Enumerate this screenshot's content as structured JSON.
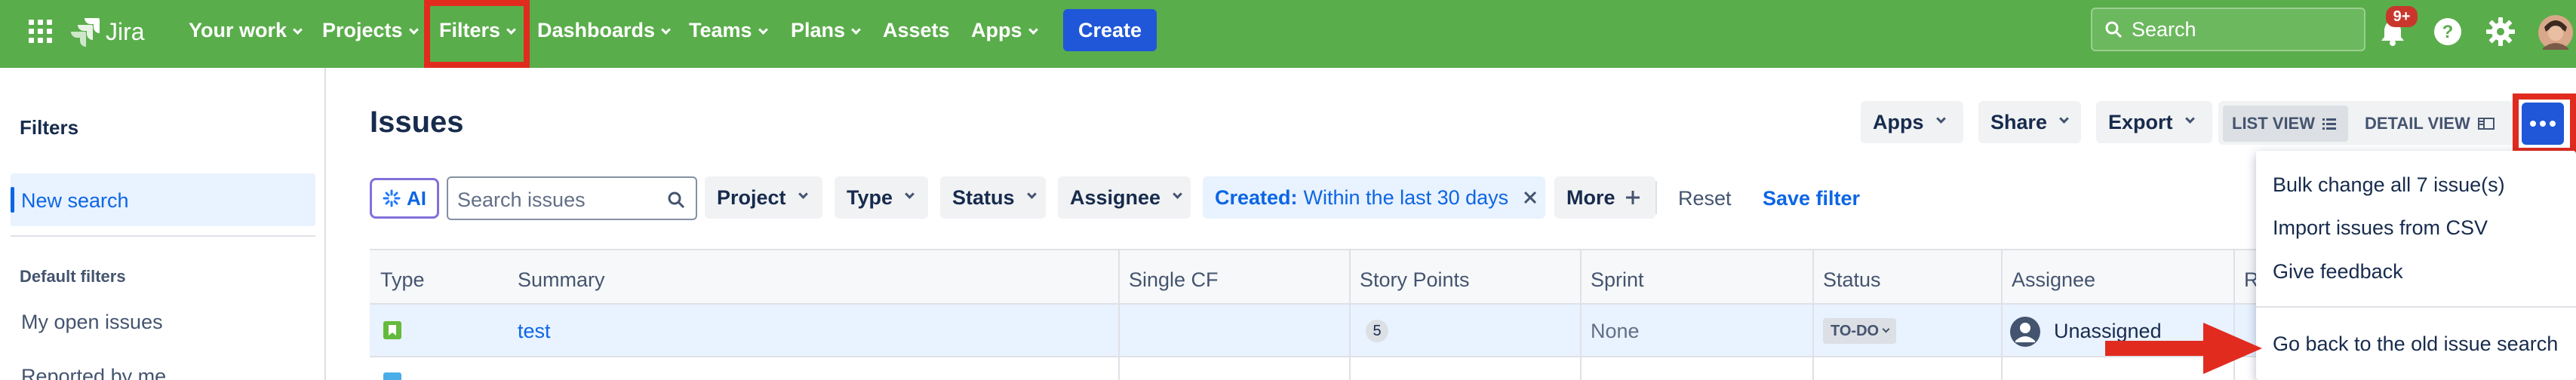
{
  "topnav": {
    "logo_text": "Jira",
    "items": [
      {
        "label": "Your work"
      },
      {
        "label": "Projects"
      },
      {
        "label": "Filters"
      },
      {
        "label": "Dashboards"
      },
      {
        "label": "Teams"
      },
      {
        "label": "Plans"
      },
      {
        "label": "Assets"
      },
      {
        "label": "Apps"
      }
    ],
    "create_label": "Create",
    "search_placeholder": "Search",
    "notification_count": "9+",
    "bg_color": "#5aad4b"
  },
  "sidebar": {
    "heading": "Filters",
    "new_search": "New search",
    "default_filters_heading": "Default filters",
    "items": [
      "My open issues",
      "Reported by me"
    ]
  },
  "main": {
    "title": "Issues",
    "header_buttons": {
      "apps": "Apps",
      "share": "Share",
      "export": "Export",
      "list_view": "LIST VIEW",
      "detail_view": "DETAIL VIEW"
    },
    "filter_bar": {
      "ai": "AI",
      "search_placeholder": "Search issues",
      "project": "Project",
      "type": "Type",
      "status": "Status",
      "assignee": "Assignee",
      "created_key": "Created:",
      "created_value": "Within the last 30 days",
      "more": "More",
      "reset": "Reset",
      "save_filter": "Save filter"
    }
  },
  "table": {
    "columns": [
      "Type",
      "Summary",
      "Single CF",
      "Story Points",
      "Sprint",
      "Status",
      "Assignee",
      "R"
    ],
    "rows": [
      {
        "summary": "test",
        "story_points": "5",
        "sprint": "None",
        "status": "TO-DO",
        "assignee": "Unassigned"
      }
    ]
  },
  "menu": {
    "items": [
      "Bulk change all 7 issue(s)",
      "Import issues from CSV",
      "Give feedback",
      "Go back to the old issue search"
    ]
  },
  "colors": {
    "annotation_red": "#e12b1f",
    "link_blue": "#0c66e4",
    "create_blue": "#1f57d8"
  }
}
